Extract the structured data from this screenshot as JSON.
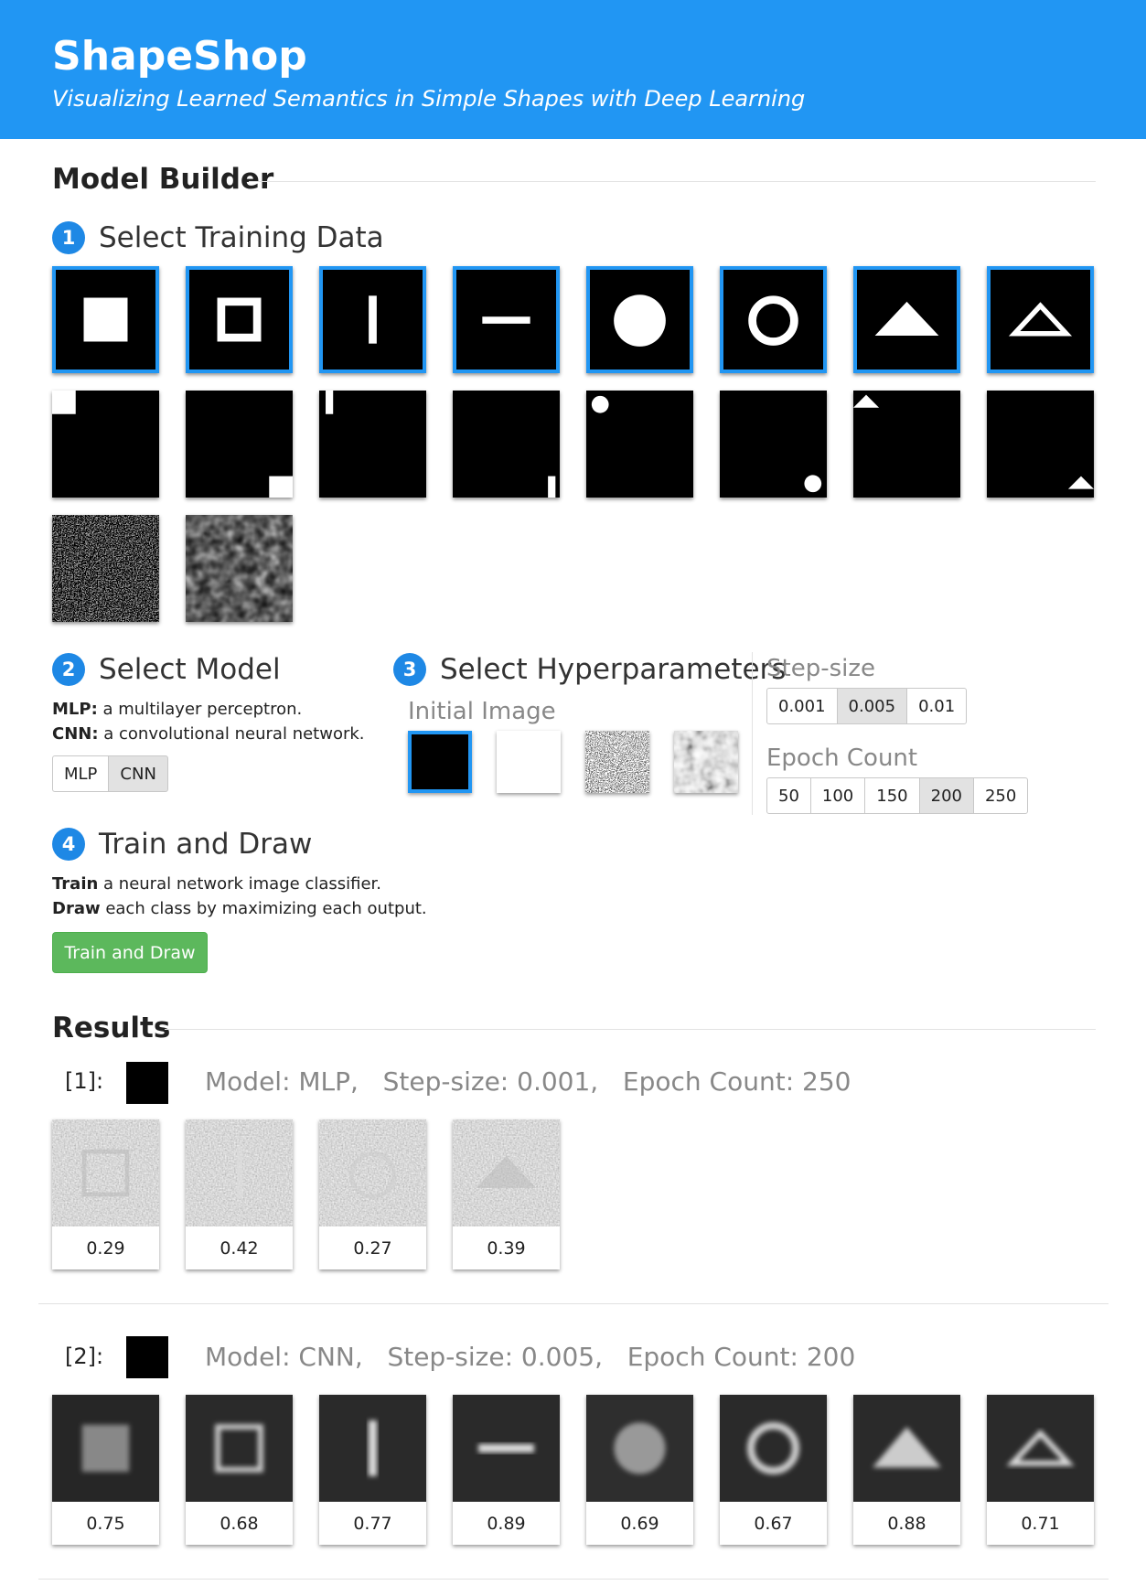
{
  "header": {
    "title": "ShapeShop",
    "subtitle": "Visualizing Learned Semantics in Simple Shapes with Deep Learning"
  },
  "model_builder": {
    "heading": "Model Builder",
    "step1": {
      "number": "1",
      "title": "Select Training Data"
    },
    "step2": {
      "number": "2",
      "title": "Select Model",
      "mlp_bold": "MLP:",
      "mlp_text": " a multilayer perceptron.",
      "cnn_bold": "CNN:",
      "cnn_text": " a convolutional neural network.",
      "options": [
        "MLP",
        "CNN"
      ],
      "selected": "CNN"
    },
    "step3": {
      "number": "3",
      "title": "Select Hyperparameters",
      "initial_image_label": "Initial Image",
      "step_size_label": "Step-size",
      "step_size_options": [
        "0.001",
        "0.005",
        "0.01"
      ],
      "step_size_selected": "0.005",
      "epoch_label": "Epoch Count",
      "epoch_options": [
        "50",
        "100",
        "150",
        "200",
        "250"
      ],
      "epoch_selected": "200"
    },
    "step4": {
      "number": "4",
      "title": "Train and Draw",
      "line1_bold": "Train",
      "line1_text": " a neural network image classifier.",
      "line2_bold": "Draw",
      "line2_text": " each class by maximizing each output.",
      "button": "Train and Draw"
    }
  },
  "results": {
    "heading": "Results",
    "runs": [
      {
        "id": "[1]:",
        "model": "Model: MLP,",
        "step_size": "Step-size: 0.001,",
        "epoch": "Epoch Count: 250",
        "scores": [
          "0.29",
          "0.42",
          "0.27",
          "0.39"
        ]
      },
      {
        "id": "[2]:",
        "model": "Model: CNN,",
        "step_size": "Step-size: 0.005,",
        "epoch": "Epoch Count: 200",
        "scores": [
          "0.75",
          "0.68",
          "0.77",
          "0.89",
          "0.69",
          "0.67",
          "0.88",
          "0.71"
        ]
      }
    ]
  }
}
